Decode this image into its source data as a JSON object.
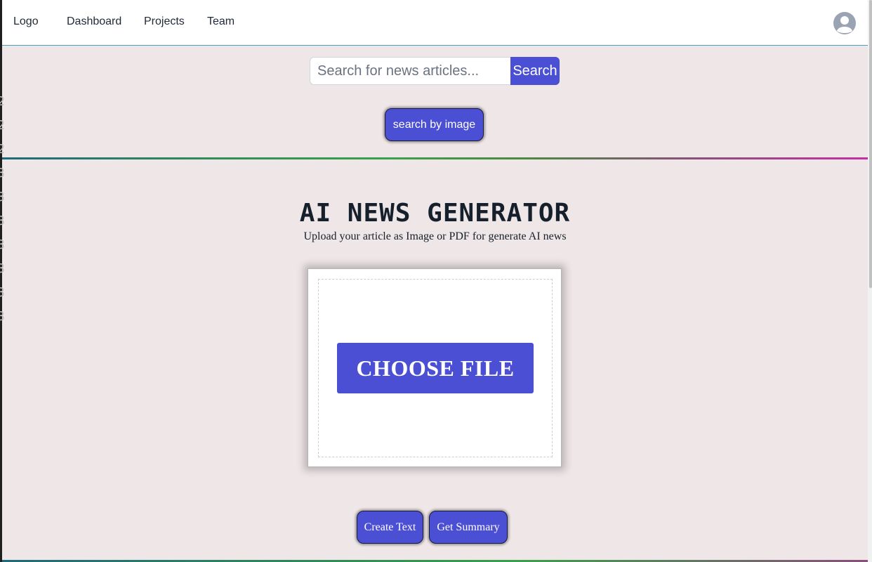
{
  "navbar": {
    "logo": "Logo",
    "links": [
      "Dashboard",
      "Projects",
      "Team"
    ],
    "avatar_icon": "user-circle-icon"
  },
  "search": {
    "placeholder": "Search for news articles...",
    "button_label": "Search",
    "image_search_label": "search by image"
  },
  "hero": {
    "title": "AI NEWS GENERATOR",
    "subtitle": "Upload your article as Image or PDF for generate AI news"
  },
  "upload": {
    "choose_file_label": "CHOOSE FILE"
  },
  "actions": {
    "create_text_label": "Create Text",
    "get_summary_label": "Get Summary"
  },
  "colors": {
    "accent": "#4b4fd3",
    "background": "#efe6e7",
    "navbar": "#ffffff",
    "text": "#16202c"
  }
}
